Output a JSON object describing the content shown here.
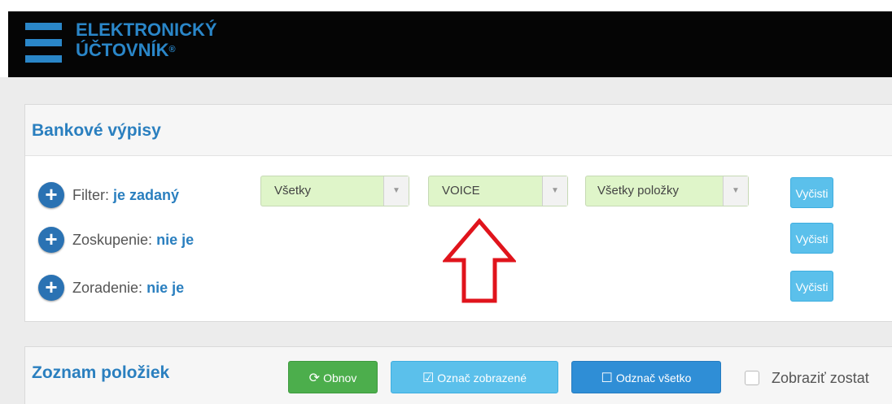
{
  "header": {
    "logo_line1": "ELEKTRONICKÝ",
    "logo_line2": "ÚČTOVNÍK",
    "logo_mark": "®"
  },
  "filters_panel": {
    "title": "Bankové výpisy",
    "rows": [
      {
        "label": "Filter:",
        "status": "je zadaný",
        "icon": "plus-circle-icon",
        "clear_label": "Vyčisti"
      },
      {
        "label": "Zoskupenie:",
        "status": "nie je",
        "icon": "plus-circle-icon",
        "clear_label": "Vyčisti"
      },
      {
        "label": "Zoradenie:",
        "status": "nie je",
        "icon": "plus-circle-icon",
        "clear_label": "Vyčisti"
      }
    ],
    "selects": [
      {
        "value": "Všetky"
      },
      {
        "value": "VOICE"
      },
      {
        "value": "Všetky položky"
      }
    ],
    "annotation_icon": "up-arrow-icon"
  },
  "list_panel": {
    "title": "Zoznam položiek",
    "refresh_label": "Obnov",
    "refresh_icon": "refresh-icon",
    "mark_label": "Označ zobrazené",
    "mark_icon": "checked-box-icon",
    "unmark_label": "Odznač všetko",
    "unmark_icon": "empty-box-icon",
    "show_label": "Zobraziť zostat"
  },
  "colors": {
    "accent": "#2a7fbf",
    "select_bg": "#dff5c9",
    "clear_btn": "#5bc0eb",
    "refresh_btn": "#4cae4c",
    "arrow": "#e0141c"
  }
}
